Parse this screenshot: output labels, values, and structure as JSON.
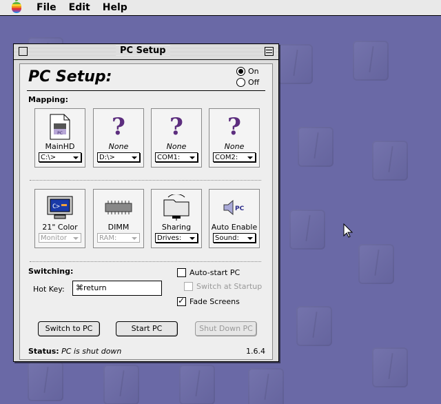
{
  "menubar": {
    "items": [
      "File",
      "Edit",
      "Help"
    ]
  },
  "window": {
    "title": "PC Setup"
  },
  "panel": {
    "heading": "PC Setup:",
    "power": {
      "on_label": "On",
      "off_label": "Off",
      "selected": "On"
    },
    "mapping_label": "Mapping:",
    "drives": [
      {
        "label": "MainHD",
        "italic": false,
        "icon": "hard-disk-icon",
        "value": "C:\\>"
      },
      {
        "label": "None",
        "italic": true,
        "icon": "question-mark-icon",
        "value": "D:\\>"
      },
      {
        "label": "None",
        "italic": true,
        "icon": "question-mark-icon",
        "value": "COM1:"
      },
      {
        "label": "None",
        "italic": true,
        "icon": "question-mark-icon",
        "value": "COM2:"
      }
    ],
    "devices": [
      {
        "label": "21\" Color",
        "icon": "monitor-icon",
        "value": "Monitor",
        "disabled": true
      },
      {
        "label": "DIMM",
        "icon": "memory-chip-icon",
        "value": "RAM:",
        "disabled": true
      },
      {
        "label": "Sharing",
        "icon": "shared-folder-icon",
        "value": "Drives:",
        "disabled": false
      },
      {
        "label": "Auto Enable",
        "icon": "speaker-icon",
        "value": "Sound:",
        "disabled": false
      }
    ],
    "switching_label": "Switching:",
    "hotkey_label": "Hot Key:",
    "hotkey_value": "⌘return",
    "autostart_label": "Auto-start PC",
    "switch_startup_label": "Switch at Startup",
    "fade_label": "Fade Screens",
    "autostart_checked": false,
    "switch_startup_checked": false,
    "fade_checked": true,
    "buttons": {
      "switch": "Switch to PC",
      "start": "Start PC",
      "shutdown": "Shut Down PC"
    },
    "status_label": "Status:",
    "status_value": "PC is shut down",
    "version": "1.6.4"
  },
  "colors": {
    "desktop": "#6a69a6",
    "accent": "#5c2d7e"
  }
}
